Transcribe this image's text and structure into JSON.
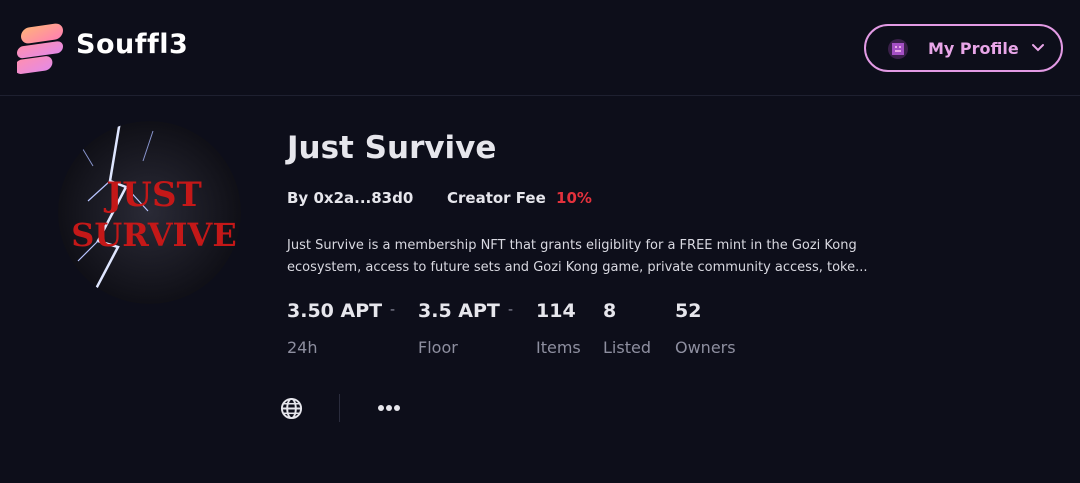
{
  "header": {
    "brand": "Souffl3",
    "profile_label": "My Profile"
  },
  "collection": {
    "title": "Just Survive",
    "creator_label": "By",
    "creator": "0x2a...83d0",
    "fee_label": "Creator Fee",
    "fee_value": "10%",
    "description_line1": "Just Survive is a membership NFT that grants eligiblity for a FREE mint in the Gozi Kong",
    "description_line2": "ecosystem, access to future sets and Gozi Kong game, private community access, toke...",
    "avatar_text_line1": "JUST",
    "avatar_text_line2": "SURVIVE"
  },
  "stats": [
    {
      "value": "3.50 APT",
      "label": "24h"
    },
    {
      "value": "3.5 APT",
      "label": "Floor"
    },
    {
      "value": "114",
      "label": "Items"
    },
    {
      "value": "8",
      "label": "Listed"
    },
    {
      "value": "52",
      "label": "Owners"
    }
  ],
  "stat_separator": "-",
  "icons": {
    "logo": "souffl3-logo",
    "profile": "avatar-icon",
    "chevron": "chevron-down-icon",
    "website": "globe-icon",
    "more": "more-icon"
  },
  "colors": {
    "background": "#0d0e1a",
    "accent": "#e29ae4",
    "fee": "#e2313c"
  }
}
